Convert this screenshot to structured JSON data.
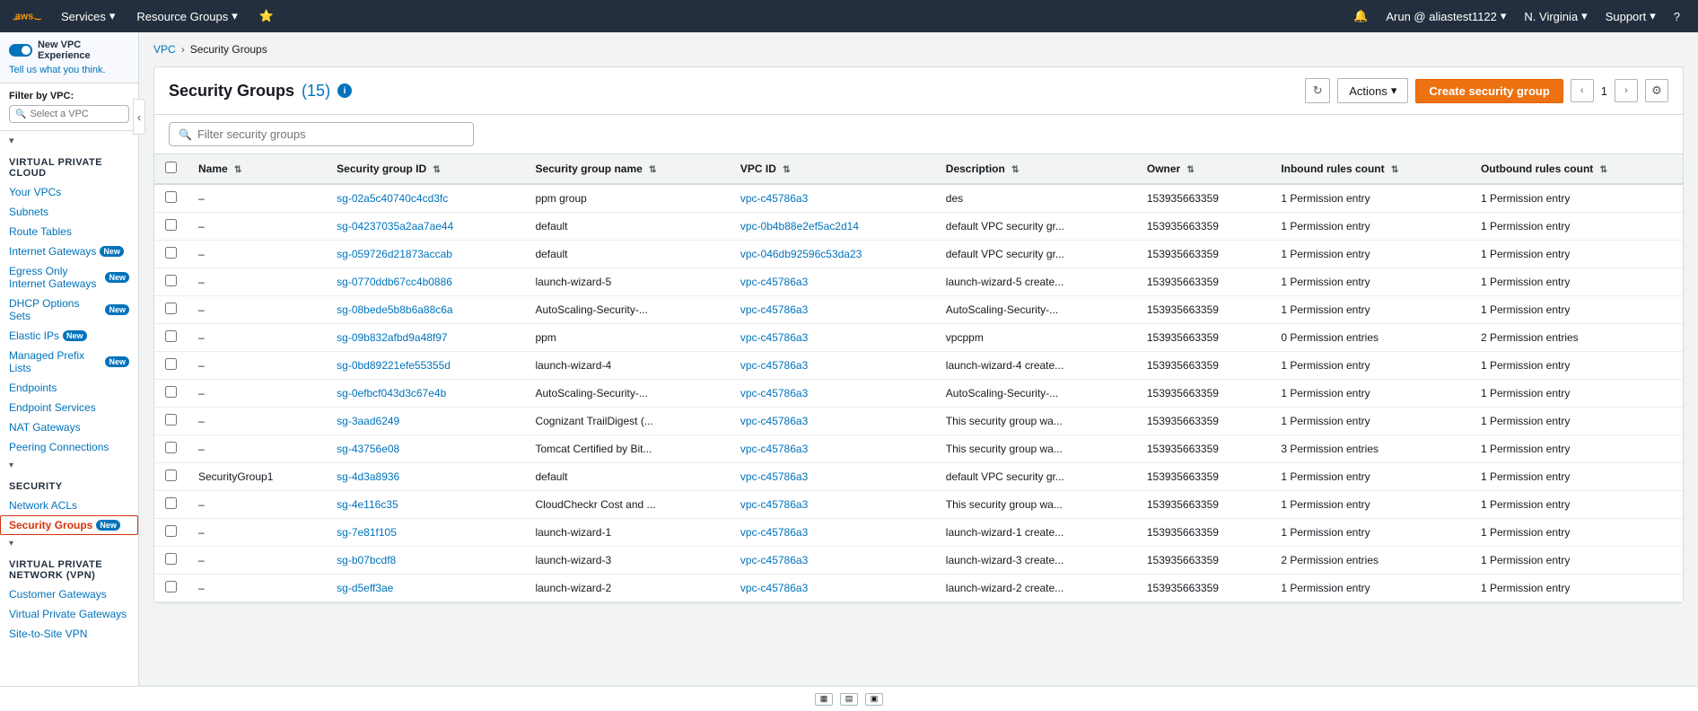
{
  "topnav": {
    "services_label": "Services",
    "resource_groups_label": "Resource Groups",
    "user_label": "Arun @ aliastest1122",
    "region_label": "N. Virginia",
    "support_label": "Support"
  },
  "sidebar": {
    "vpc_experience_label": "New VPC Experience",
    "vpc_experience_sub": "Tell us what you think.",
    "filter_label": "Filter by VPC:",
    "filter_placeholder": "Select a VPC",
    "sections": [
      {
        "title": "VIRTUAL PRIVATE CLOUD",
        "items": [
          {
            "label": "Your VPCs",
            "active": false,
            "badge": null
          },
          {
            "label": "Subnets",
            "active": false,
            "badge": null
          },
          {
            "label": "Route Tables",
            "active": false,
            "badge": null
          },
          {
            "label": "Internet Gateways",
            "active": false,
            "badge": "New"
          },
          {
            "label": "Egress Only Internet Gateways",
            "active": false,
            "badge": "New"
          },
          {
            "label": "DHCP Options Sets",
            "active": false,
            "badge": "New"
          },
          {
            "label": "Elastic IPs",
            "active": false,
            "badge": "New"
          },
          {
            "label": "Managed Prefix Lists",
            "active": false,
            "badge": "New"
          },
          {
            "label": "Endpoints",
            "active": false,
            "badge": null
          },
          {
            "label": "Endpoint Services",
            "active": false,
            "badge": null
          },
          {
            "label": "NAT Gateways",
            "active": false,
            "badge": null
          },
          {
            "label": "Peering Connections",
            "active": false,
            "badge": null
          }
        ]
      },
      {
        "title": "SECURITY",
        "items": [
          {
            "label": "Network ACLs",
            "active": false,
            "badge": null
          },
          {
            "label": "Security Groups",
            "active": true,
            "badge": "New"
          }
        ]
      },
      {
        "title": "VIRTUAL PRIVATE NETWORK (VPN)",
        "items": [
          {
            "label": "Customer Gateways",
            "active": false,
            "badge": null
          },
          {
            "label": "Virtual Private Gateways",
            "active": false,
            "badge": null
          },
          {
            "label": "Site-to-Site VPN",
            "active": false,
            "badge": null
          }
        ]
      }
    ]
  },
  "breadcrumb": {
    "vpc_label": "VPC",
    "current_label": "Security Groups"
  },
  "panel": {
    "title": "Security Groups",
    "count": "(15)",
    "info_label": "Info",
    "search_placeholder": "Filter security groups",
    "actions_label": "Actions",
    "create_label": "Create security group",
    "page_number": "1"
  },
  "table": {
    "columns": [
      {
        "label": "Name",
        "key": "name"
      },
      {
        "label": "Security group ID",
        "key": "sg_id"
      },
      {
        "label": "Security group name",
        "key": "sg_name"
      },
      {
        "label": "VPC ID",
        "key": "vpc_id"
      },
      {
        "label": "Description",
        "key": "description"
      },
      {
        "label": "Owner",
        "key": "owner"
      },
      {
        "label": "Inbound rules count",
        "key": "inbound"
      },
      {
        "label": "Outbound rules count",
        "key": "outbound"
      }
    ],
    "rows": [
      {
        "name": "–",
        "sg_id": "sg-02a5c40740c4cd3fc",
        "sg_name": "ppm group",
        "vpc_id": "vpc-c45786a3",
        "description": "des",
        "owner": "153935663359",
        "inbound": "1 Permission entry",
        "outbound": "1 Permission entry"
      },
      {
        "name": "–",
        "sg_id": "sg-04237035a2aa7ae44",
        "sg_name": "default",
        "vpc_id": "vpc-0b4b88e2ef5ac2d14",
        "description": "default VPC security gr...",
        "owner": "153935663359",
        "inbound": "1 Permission entry",
        "outbound": "1 Permission entry"
      },
      {
        "name": "–",
        "sg_id": "sg-059726d21873accab",
        "sg_name": "default",
        "vpc_id": "vpc-046db92596c53da23",
        "description": "default VPC security gr...",
        "owner": "153935663359",
        "inbound": "1 Permission entry",
        "outbound": "1 Permission entry"
      },
      {
        "name": "–",
        "sg_id": "sg-0770ddb67cc4b0886",
        "sg_name": "launch-wizard-5",
        "vpc_id": "vpc-c45786a3",
        "description": "launch-wizard-5 create...",
        "owner": "153935663359",
        "inbound": "1 Permission entry",
        "outbound": "1 Permission entry"
      },
      {
        "name": "–",
        "sg_id": "sg-08bede5b8b6a88c6a",
        "sg_name": "AutoScaling-Security-...",
        "vpc_id": "vpc-c45786a3",
        "description": "AutoScaling-Security-...",
        "owner": "153935663359",
        "inbound": "1 Permission entry",
        "outbound": "1 Permission entry"
      },
      {
        "name": "–",
        "sg_id": "sg-09b832afbd9a48f97",
        "sg_name": "ppm",
        "vpc_id": "vpc-c45786a3",
        "description": "vpcppm",
        "owner": "153935663359",
        "inbound": "0 Permission entries",
        "outbound": "2 Permission entries"
      },
      {
        "name": "–",
        "sg_id": "sg-0bd89221efe55355d",
        "sg_name": "launch-wizard-4",
        "vpc_id": "vpc-c45786a3",
        "description": "launch-wizard-4 create...",
        "owner": "153935663359",
        "inbound": "1 Permission entry",
        "outbound": "1 Permission entry"
      },
      {
        "name": "–",
        "sg_id": "sg-0efbcf043d3c67e4b",
        "sg_name": "AutoScaling-Security-...",
        "vpc_id": "vpc-c45786a3",
        "description": "AutoScaling-Security-...",
        "owner": "153935663359",
        "inbound": "1 Permission entry",
        "outbound": "1 Permission entry"
      },
      {
        "name": "–",
        "sg_id": "sg-3aad6249",
        "sg_name": "Cognizant TrailDigest (...",
        "vpc_id": "vpc-c45786a3",
        "description": "This security group wa...",
        "owner": "153935663359",
        "inbound": "1 Permission entry",
        "outbound": "1 Permission entry"
      },
      {
        "name": "–",
        "sg_id": "sg-43756e08",
        "sg_name": "Tomcat Certified by Bit...",
        "vpc_id": "vpc-c45786a3",
        "description": "This security group wa...",
        "owner": "153935663359",
        "inbound": "3 Permission entries",
        "outbound": "1 Permission entry"
      },
      {
        "name": "SecurityGroup1",
        "sg_id": "sg-4d3a8936",
        "sg_name": "default",
        "vpc_id": "vpc-c45786a3",
        "description": "default VPC security gr...",
        "owner": "153935663359",
        "inbound": "1 Permission entry",
        "outbound": "1 Permission entry"
      },
      {
        "name": "–",
        "sg_id": "sg-4e116c35",
        "sg_name": "CloudCheckr Cost and ...",
        "vpc_id": "vpc-c45786a3",
        "description": "This security group wa...",
        "owner": "153935663359",
        "inbound": "1 Permission entry",
        "outbound": "1 Permission entry"
      },
      {
        "name": "–",
        "sg_id": "sg-7e81f105",
        "sg_name": "launch-wizard-1",
        "vpc_id": "vpc-c45786a3",
        "description": "launch-wizard-1 create...",
        "owner": "153935663359",
        "inbound": "1 Permission entry",
        "outbound": "1 Permission entry"
      },
      {
        "name": "–",
        "sg_id": "sg-b07bcdf8",
        "sg_name": "launch-wizard-3",
        "vpc_id": "vpc-c45786a3",
        "description": "launch-wizard-3 create...",
        "owner": "153935663359",
        "inbound": "2 Permission entries",
        "outbound": "1 Permission entry"
      },
      {
        "name": "–",
        "sg_id": "sg-d5eff3ae",
        "sg_name": "launch-wizard-2",
        "vpc_id": "vpc-c45786a3",
        "description": "launch-wizard-2 create...",
        "owner": "153935663359",
        "inbound": "1 Permission entry",
        "outbound": "1 Permission entry"
      }
    ]
  },
  "icons": {
    "chevron_right": "›",
    "chevron_down": "▾",
    "chevron_left": "‹",
    "chevron_up": "▴",
    "search": "🔍",
    "refresh": "↻",
    "settings": "⚙",
    "bell": "🔔",
    "sort": "⇅",
    "toggle_left": "◀",
    "view1": "▦",
    "view2": "▤",
    "view3": "▣"
  }
}
